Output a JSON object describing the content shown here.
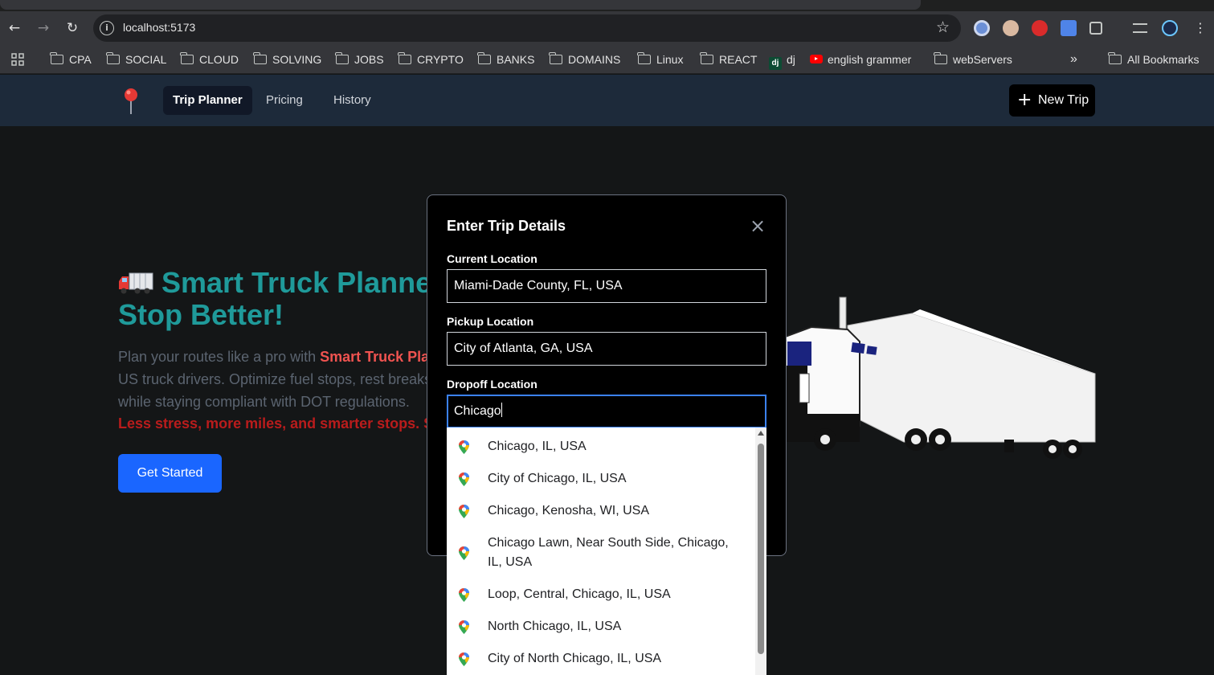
{
  "browser": {
    "url": "localhost:5173",
    "bookmarks": [
      "CPA",
      "SOCIAL",
      "CLOUD",
      "SOLVING",
      "JOBS",
      "CRYPTO",
      "BANKS",
      "DOMAINS",
      "Linux",
      "REACT"
    ],
    "bookmark_dj": "dj",
    "bookmark_english": "english grammer",
    "bookmark_webservers": "webServers",
    "overflow": "»",
    "all_bookmarks": "All Bookmarks"
  },
  "nav": {
    "items": [
      "Trip Planner",
      "Pricing",
      "History"
    ],
    "active": "Trip Planner",
    "new_trip": "New Trip"
  },
  "hero": {
    "title_line1": "Smart Truck Planner",
    "title_line2": "Stop Better!",
    "desc_prefix": "Plan your routes like a pro with ",
    "desc_highlight": "Smart Truck Plan",
    "desc_rest": "US truck drivers. Optimize fuel stops, rest breaks, while staying compliant with DOT regulations.",
    "red_line": "Less stress, more miles, and smarter stops. Sta",
    "cta": "Get Started"
  },
  "modal": {
    "title": "Enter Trip Details",
    "current_label": "Current Location",
    "current_value": "Miami-Dade County, FL, USA",
    "pickup_label": "Pickup Location",
    "pickup_value": "City of Atlanta, GA, USA",
    "dropoff_label": "Dropoff Location",
    "dropoff_value": "Chicago"
  },
  "suggestions": [
    "Chicago, IL, USA",
    "City of Chicago, IL, USA",
    "Chicago, Kenosha, WI, USA",
    "Chicago Lawn, Near South Side, Chicago, IL, USA",
    "Loop, Central, Chicago, IL, USA",
    "North Chicago, IL, USA",
    "City of North Chicago, IL, USA"
  ],
  "colors": {
    "accent": "#1f9a9a",
    "header_bg": "#1d2a3a",
    "cta_blue": "#1a66ff",
    "highlight_red": "#ef5350"
  }
}
